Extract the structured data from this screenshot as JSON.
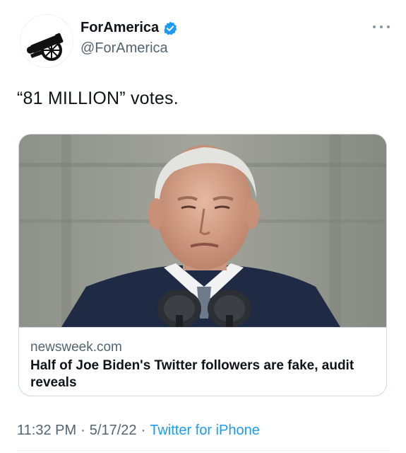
{
  "author": {
    "display_name": "ForAmerica",
    "handle": "@ForAmerica",
    "verified": true,
    "avatar_icon": "cannon-icon"
  },
  "tweet": {
    "text": "“81 MILLION” votes."
  },
  "link_card": {
    "domain": "newsweek.com",
    "title": "Half of Joe Biden's Twitter followers are fake, audit reveals"
  },
  "meta": {
    "time": "11:32 PM",
    "date": "5/17/22",
    "separator": "·",
    "source": "Twitter for iPhone"
  },
  "colors": {
    "accent": "#1d9bf0",
    "secondary_text": "#536471",
    "border": "#cfd9de"
  }
}
